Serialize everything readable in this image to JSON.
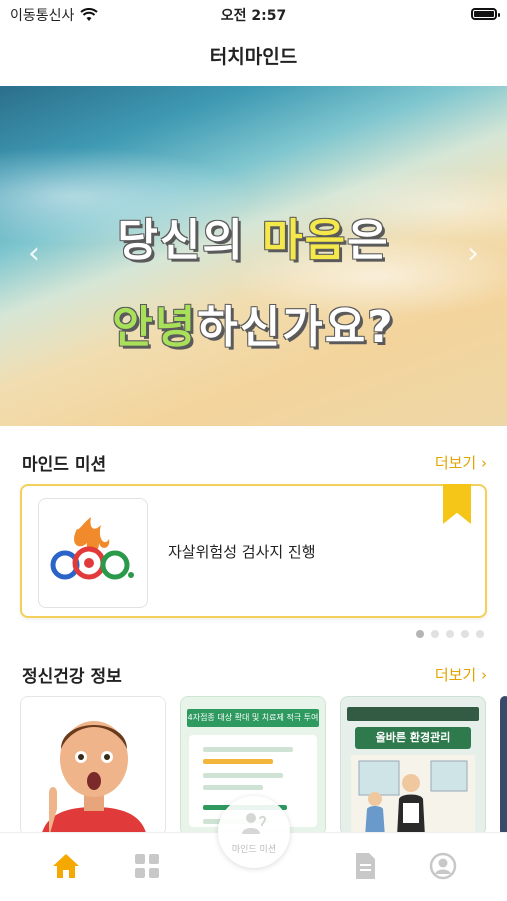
{
  "status_bar": {
    "carrier": "이동통신사",
    "time": "오전 2:57"
  },
  "nav": {
    "title": "터치마인드"
  },
  "banner": {
    "line1_part1": "당신의 ",
    "line1_highlight": "마음",
    "line1_part2": "은",
    "line2_highlight": "안녕",
    "line2_part2": "하신가요?",
    "prev_icon": "chevron-left-icon",
    "next_icon": "chevron-right-icon"
  },
  "mind_mission": {
    "title": "마인드 미션",
    "more": "더보기 ›",
    "card_text": "자살위험성 검사지 진행",
    "pagination": {
      "total": 5,
      "active": 0
    }
  },
  "mental_health_info": {
    "title": "정신건강 정보",
    "more": "더보기 ›",
    "cards": [
      {
        "alt": "boy"
      },
      {
        "header": "4자접종 대상 확대 및 치료제 적극 투여"
      },
      {
        "title": "올바른 환경관리"
      }
    ]
  },
  "tab_bar": {
    "tabs": [
      "home-icon",
      "grid-icon",
      "mind-mission-icon",
      "document-icon",
      "profile-icon"
    ],
    "center_label": "마인드 미션",
    "active_color": "#f5a800"
  },
  "colors": {
    "accent": "#e2a400",
    "ribbon": "#f5c518",
    "card_border": "#f2d05a"
  }
}
